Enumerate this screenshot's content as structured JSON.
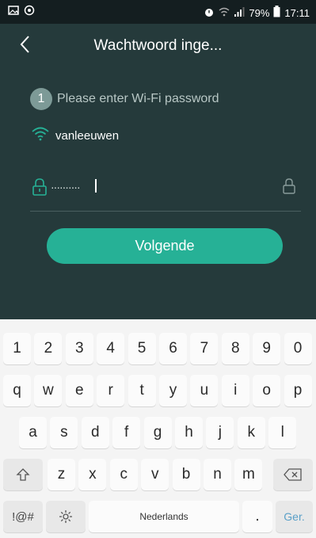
{
  "status_bar": {
    "left_icons": [
      "gallery-icon",
      "whatsapp-icon"
    ],
    "battery_percent": "79%",
    "time": "17:11"
  },
  "header": {
    "title": "Wachtwoord inge...",
    "back_icon": "chevron-left-icon"
  },
  "step": {
    "number": "1",
    "text": "Please enter Wi-Fi password"
  },
  "wifi": {
    "ssid": "vanleeuwen",
    "icon": "wifi-icon"
  },
  "password": {
    "value": "··········"
  },
  "next_button": {
    "label": "Volgende",
    "color": "#26b196"
  },
  "keyboard": {
    "row1": [
      "1",
      "2",
      "3",
      "4",
      "5",
      "6",
      "7",
      "8",
      "9",
      "0"
    ],
    "row2": [
      "q",
      "w",
      "e",
      "r",
      "t",
      "y",
      "u",
      "i",
      "o",
      "p"
    ],
    "row3": [
      "a",
      "s",
      "d",
      "f",
      "g",
      "h",
      "j",
      "k",
      "l"
    ],
    "row4": [
      "z",
      "x",
      "c",
      "v",
      "b",
      "n",
      "m"
    ],
    "symbols_label": "!@#",
    "space_label": "Nederlands",
    "period_label": ".",
    "enter_label": "Ger."
  }
}
